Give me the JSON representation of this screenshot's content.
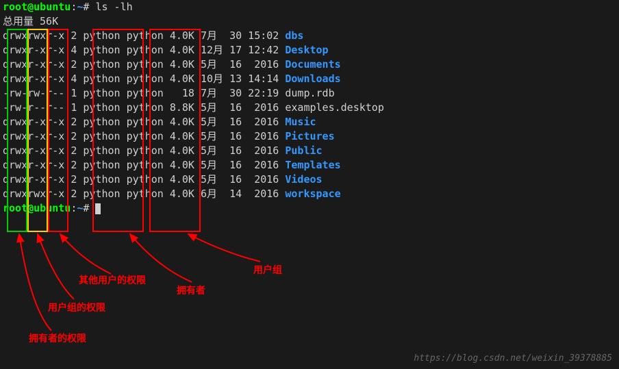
{
  "prompt": {
    "user": "root",
    "host": "ubuntu",
    "path": "~",
    "symbol": "#"
  },
  "command": "ls -lh",
  "total_line": "总用量 56K",
  "rows": [
    {
      "perms": "drwxrwxr-x",
      "links": "2",
      "owner": "python",
      "group": "python",
      "size": "4.0K",
      "month": "7月 ",
      "day": "30",
      "time": "15:02",
      "name": "dbs",
      "is_dir": true
    },
    {
      "perms": "drwxr-xr-x",
      "links": "4",
      "owner": "python",
      "group": "python",
      "size": "4.0K",
      "month": "12月",
      "day": "17",
      "time": "12:42",
      "name": "Desktop",
      "is_dir": true
    },
    {
      "perms": "drwxr-xr-x",
      "links": "2",
      "owner": "python",
      "group": "python",
      "size": "4.0K",
      "month": "5月 ",
      "day": "16",
      "time": " 2016",
      "name": "Documents",
      "is_dir": true
    },
    {
      "perms": "drwxr-xr-x",
      "links": "4",
      "owner": "python",
      "group": "python",
      "size": "4.0K",
      "month": "10月",
      "day": "13",
      "time": "14:14",
      "name": "Downloads",
      "is_dir": true
    },
    {
      "perms": "-rw-rw-r--",
      "links": "1",
      "owner": "python",
      "group": "python",
      "size": "  18",
      "month": "7月 ",
      "day": "30",
      "time": "22:19",
      "name": "dump.rdb",
      "is_dir": false
    },
    {
      "perms": "-rw-r--r--",
      "links": "1",
      "owner": "python",
      "group": "python",
      "size": "8.8K",
      "month": "5月 ",
      "day": "16",
      "time": " 2016",
      "name": "examples.desktop",
      "is_dir": false
    },
    {
      "perms": "drwxr-xr-x",
      "links": "2",
      "owner": "python",
      "group": "python",
      "size": "4.0K",
      "month": "5月 ",
      "day": "16",
      "time": " 2016",
      "name": "Music",
      "is_dir": true
    },
    {
      "perms": "drwxr-xr-x",
      "links": "2",
      "owner": "python",
      "group": "python",
      "size": "4.0K",
      "month": "5月 ",
      "day": "16",
      "time": " 2016",
      "name": "Pictures",
      "is_dir": true
    },
    {
      "perms": "drwxr-xr-x",
      "links": "2",
      "owner": "python",
      "group": "python",
      "size": "4.0K",
      "month": "5月 ",
      "day": "16",
      "time": " 2016",
      "name": "Public",
      "is_dir": true
    },
    {
      "perms": "drwxr-xr-x",
      "links": "2",
      "owner": "python",
      "group": "python",
      "size": "4.0K",
      "month": "5月 ",
      "day": "16",
      "time": " 2016",
      "name": "Templates",
      "is_dir": true
    },
    {
      "perms": "drwxr-xr-x",
      "links": "2",
      "owner": "python",
      "group": "python",
      "size": "4.0K",
      "month": "5月 ",
      "day": "16",
      "time": " 2016",
      "name": "Videos",
      "is_dir": true
    },
    {
      "perms": "drwxrwxr-x",
      "links": "2",
      "owner": "python",
      "group": "python",
      "size": "4.0K",
      "month": "6月 ",
      "day": "14",
      "time": " 2016",
      "name": "workspace",
      "is_dir": true
    }
  ],
  "annotations": {
    "owner_perms": "拥有者的权限",
    "group_perms": "用户组的权限",
    "other_perms": "其他用户的权限",
    "owner": "拥有者",
    "group": "用户组"
  },
  "watermark": "https://blog.csdn.net/weixin_39378885"
}
